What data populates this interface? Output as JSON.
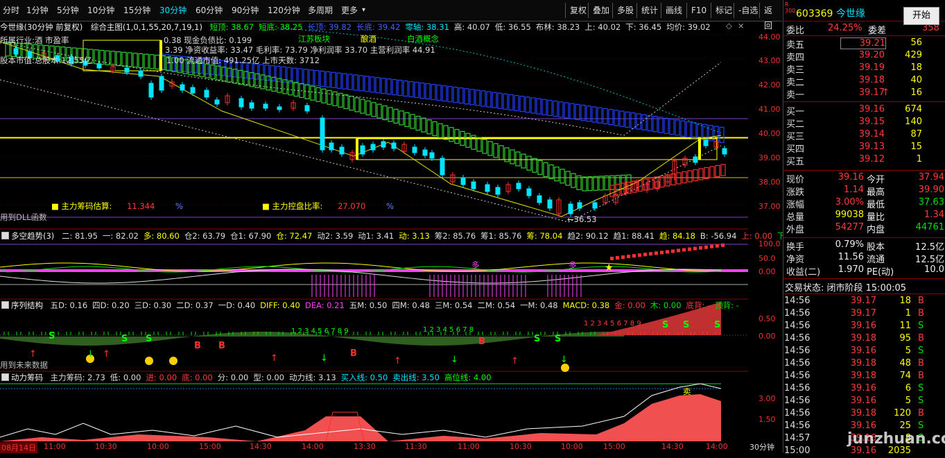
{
  "toolbar": {
    "periods": [
      "分时",
      "1分钟",
      "5分钟",
      "10分钟",
      "15分钟",
      "30分钟",
      "60分钟",
      "90分钟",
      "120分钟",
      "多周期",
      "更多"
    ],
    "active_period": "30分钟",
    "actions": [
      "复权",
      "叠加",
      "多股",
      "统计",
      "画线",
      "F10",
      "标记",
      "-自选",
      "返回"
    ]
  },
  "main_chart": {
    "title": "今世缘(30分钟 前复权)",
    "indicator_name": "综合主图(1,0,1,55,20,7,19,1)",
    "values": [
      {
        "label": "短顶: 38.67",
        "color": "#00ff00"
      },
      {
        "label": "短底: 38.25",
        "color": "#00ff00"
      },
      {
        "label": "长顶: 39.82",
        "color": "#4060ff"
      },
      {
        "label": "长底: 39.42",
        "color": "#4060ff"
      },
      {
        "label": "零轴: 38.31",
        "color": "#00e5ff"
      },
      {
        "label": "高: 40.07",
        "color": "#dddddd"
      },
      {
        "label": "低: 36.55",
        "color": "#dddddd"
      },
      {
        "label": "布林: 38.23",
        "color": "#dddddd"
      },
      {
        "label": "上: 40.02",
        "color": "#dddddd"
      },
      {
        "label": "下: 36.45",
        "color": "#dddddd"
      },
      {
        "label": "均价: 39.02",
        "color": "#dddddd"
      }
    ],
    "fund_line1": "0.38 现金负债比: 0.199",
    "fund_line2": "3.39 净资收益率: 33.47 毛利率: 73.79 净利润率 33.70 主营利润率 44.91",
    "fund_line3": "1.00 流通市值: 491.25亿 上市天数: 3712",
    "fund_partial_a": "所属行业:酒 市盈率",
    "fund_partial_b": "股本市值:总股本:12.55亿",
    "tags": [
      "江苏板块",
      "酿酒",
      "白酒概念"
    ],
    "chip_estimate_label": "主力筹码估算:",
    "chip_estimate_value": "11.344",
    "chip_estimate_unit": "%",
    "control_ratio_label": "主力控盘比率:",
    "control_ratio_value": "27.070",
    "control_ratio_unit": "%",
    "dll_note": "用到DLL函数",
    "low_marker": "36.53",
    "y_axis": [
      "44.00",
      "43.00",
      "42.00",
      "41.00",
      "40.00",
      "39.00",
      "38.00",
      "37.00"
    ]
  },
  "panel2": {
    "title": "多空趋势(3)",
    "values": [
      {
        "label": "二: 81.95",
        "color": "#dddddd"
      },
      {
        "label": "一: 82.02",
        "color": "#dddddd"
      },
      {
        "label": "多: 80.60",
        "color": "#ffff00"
      },
      {
        "label": "仓2: 63.79",
        "color": "#dddddd"
      },
      {
        "label": "仓1: 67.90",
        "color": "#dddddd"
      },
      {
        "label": "仓: 72.47",
        "color": "#ffff00"
      },
      {
        "label": "动2: 3.59",
        "color": "#dddddd"
      },
      {
        "label": "动1: 3.41",
        "color": "#dddddd"
      },
      {
        "label": "动: 3.13",
        "color": "#ffff00"
      },
      {
        "label": "筹2: 85.76",
        "color": "#dddddd"
      },
      {
        "label": "筹1: 85.76",
        "color": "#dddddd"
      },
      {
        "label": "筹: 78.04",
        "color": "#ffff00"
      },
      {
        "label": "趋2: 90.12",
        "color": "#dddddd"
      },
      {
        "label": "趋1: 88.41",
        "color": "#dddddd"
      },
      {
        "label": "趋: 84.18",
        "color": "#ffff00"
      },
      {
        "label": "B: -56.94",
        "color": "#dddddd"
      },
      {
        "label": "上: 0.00",
        "color": "#ff3b3b"
      },
      {
        "label": "下: 0.00",
        "color": "#00e000"
      }
    ],
    "y_axis": [
      "100.0",
      "50.0",
      "0.00"
    ],
    "marker_text": "多"
  },
  "panel3": {
    "title": "序列结构",
    "values": [
      {
        "label": "五D: 0.16",
        "color": "#dddddd"
      },
      {
        "label": "四D: 0.20",
        "color": "#dddddd"
      },
      {
        "label": "三D: 0.30",
        "color": "#dddddd"
      },
      {
        "label": "二D: 0.37",
        "color": "#dddddd"
      },
      {
        "label": "一D: 0.40",
        "color": "#dddddd"
      },
      {
        "label": "DIFF: 0.40",
        "color": "#ffff00"
      },
      {
        "label": "DEA: 0.21",
        "color": "#ff40ff"
      },
      {
        "label": "五M: 0.50",
        "color": "#dddddd"
      },
      {
        "label": "四M: 0.48",
        "color": "#dddddd"
      },
      {
        "label": "三M: 0.54",
        "color": "#dddddd"
      },
      {
        "label": "二M: 0.54",
        "color": "#dddddd"
      },
      {
        "label": "一M: 0.48",
        "color": "#dddddd"
      },
      {
        "label": "MACD: 0.38",
        "color": "#ffff00"
      },
      {
        "label": "金: 0.00",
        "color": "#ff3b3b"
      },
      {
        "label": "木: 0.00",
        "color": "#00e000"
      },
      {
        "label": "底背: -",
        "color": "#ff3b3b"
      },
      {
        "label": "顶背: -",
        "color": "#00e000"
      }
    ],
    "y_axis": [
      "0.50",
      "0.00"
    ],
    "future_note": "用到未来数据",
    "seq_text_1": "1 2 3 4 5 6 7 8 9",
    "seq_text_2": "1 2 3 4 5 6 7 8",
    "seq_text_3": "1 2 3 4 5 6 7 8 9"
  },
  "panel4": {
    "title": "动力筹码",
    "values": [
      {
        "label": "主力筹码: 2.73",
        "color": "#dddddd"
      },
      {
        "label": "低: 0.00",
        "color": "#dddddd"
      },
      {
        "label": "进: 0.00",
        "color": "#ff3b3b"
      },
      {
        "label": "底: 0.00",
        "color": "#ff3b3b"
      },
      {
        "label": "分: 0.00",
        "color": "#dddddd"
      },
      {
        "label": "型: 0.00",
        "color": "#dddddd"
      },
      {
        "label": "动力线: 3.13",
        "color": "#dddddd"
      },
      {
        "label": "买入线: 0.50",
        "color": "#00e5ff"
      },
      {
        "label": "卖出线: 3.50",
        "color": "#00e5ff"
      },
      {
        "label": "高位线: 4.00",
        "color": "#00ff00"
      }
    ],
    "y_axis": [
      "3.00",
      "1.50"
    ],
    "marker_text": "卖"
  },
  "x_axis": [
    "08月14日",
    "11:00",
    "10:30",
    "10:00",
    "15:00",
    "14:30",
    "14:00",
    "13:30",
    "11:30",
    "11:00",
    "10:30",
    "10:00",
    "15:00",
    "14:30",
    "14:00"
  ],
  "period_label": "30分钟",
  "quote": {
    "badge_r": "R",
    "badge_300": "300",
    "code": "603369",
    "name": "今世缘",
    "start_button": "开始",
    "ratio_label": "委比",
    "ratio_value": "24.25%",
    "diff_label": "委差",
    "diff_value": "358",
    "sells": [
      {
        "label": "卖五",
        "price": "39.21",
        "vol": "56"
      },
      {
        "label": "卖四",
        "price": "39.20",
        "vol": "429"
      },
      {
        "label": "卖三",
        "price": "39.19",
        "vol": "18"
      },
      {
        "label": "卖二",
        "price": "39.18",
        "vol": "40"
      },
      {
        "label": "卖一",
        "price": "39.17",
        "vol": "16"
      }
    ],
    "buys": [
      {
        "label": "买一",
        "price": "39.16",
        "vol": "674"
      },
      {
        "label": "买二",
        "price": "39.15",
        "vol": "140"
      },
      {
        "label": "买三",
        "price": "39.14",
        "vol": "87"
      },
      {
        "label": "买四",
        "price": "39.13",
        "vol": "15"
      },
      {
        "label": "买五",
        "price": "39.12",
        "vol": "1"
      }
    ],
    "stats": [
      {
        "l1": "现价",
        "v1": "39.16",
        "c1": "red",
        "l2": "今开",
        "v2": "37.94",
        "c2": "red"
      },
      {
        "l1": "涨跌",
        "v1": "1.14",
        "c1": "red",
        "l2": "最高",
        "v2": "39.90",
        "c2": "red"
      },
      {
        "l1": "涨幅",
        "v1": "3.00%",
        "c1": "red",
        "l2": "最低",
        "v2": "37.63",
        "c2": "green"
      },
      {
        "l1": "总量",
        "v1": "99038",
        "c1": "yel",
        "l2": "量比",
        "v2": "1.34",
        "c2": "red"
      },
      {
        "l1": "外盘",
        "v1": "54277",
        "c1": "red",
        "l2": "内盘",
        "v2": "44761",
        "c2": "green"
      }
    ],
    "stats2": [
      {
        "l1": "换手",
        "v1": "0.79%",
        "l2": "股本",
        "v2": "12.5亿"
      },
      {
        "l1": "净资",
        "v1": "11.56",
        "l2": "流通",
        "v2": "12.5亿"
      },
      {
        "l1": "收益(二)",
        "v1": "1.970",
        "l2": "PE(动)",
        "v2": "10.0"
      }
    ],
    "trade_status": "交易状态: 闭市阶段 15:00:05",
    "ticks": [
      {
        "t": "14:56",
        "p": "39.17",
        "v": "18",
        "bs": "B"
      },
      {
        "t": "14:56",
        "p": "39.17",
        "v": "1",
        "bs": "B"
      },
      {
        "t": "14:56",
        "p": "39.16",
        "v": "11",
        "bs": "S"
      },
      {
        "t": "14:56",
        "p": "39.18",
        "v": "95",
        "bs": "B"
      },
      {
        "t": "14:56",
        "p": "39.16",
        "v": "5",
        "bs": "S"
      },
      {
        "t": "14:56",
        "p": "39.18",
        "v": "48",
        "bs": "B"
      },
      {
        "t": "14:56",
        "p": "39.18",
        "v": "74",
        "bs": "B"
      },
      {
        "t": "14:56",
        "p": "39.16",
        "v": "6",
        "bs": "S"
      },
      {
        "t": "14:56",
        "p": "39.16",
        "v": "5",
        "bs": "S"
      },
      {
        "t": "14:56",
        "p": "39.18",
        "v": "120",
        "bs": "B"
      },
      {
        "t": "14:56",
        "p": "39.16",
        "v": "25",
        "bs": "S"
      },
      {
        "t": "14:57",
        "p": "39.16",
        "v": "8",
        "bs": "S"
      },
      {
        "t": "15:00",
        "p": "39.16",
        "v": "2035",
        "bs": ""
      }
    ]
  },
  "watermark": "junzhuan.com",
  "colors": {
    "up": "#ff3b3b",
    "down": "#00e5ff",
    "accent": "#00e5ff"
  }
}
